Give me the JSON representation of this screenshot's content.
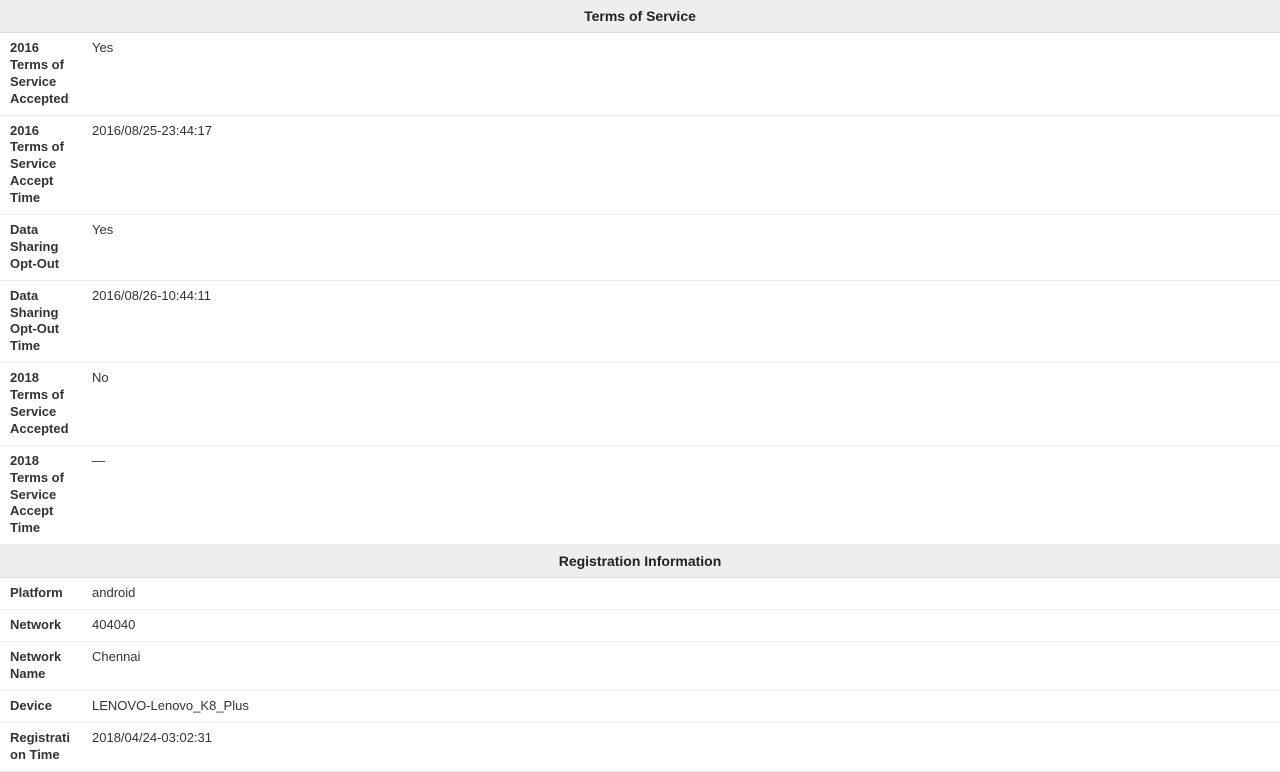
{
  "sections": [
    {
      "title": "Terms of Service",
      "rows": [
        {
          "label": "2016 Terms of Service Accepted",
          "value": "Yes"
        },
        {
          "label": "2016 Terms of Service Accept Time",
          "value": "2016/08/25-23:44:17"
        },
        {
          "label": "Data Sharing Opt-Out",
          "value": "Yes"
        },
        {
          "label": "Data Sharing Opt-Out Time",
          "value": "2016/08/26-10:44:11"
        },
        {
          "label": "2018 Terms of Service Accepted",
          "value": "No"
        },
        {
          "label": "2018 Terms of Service Accept Time",
          "value": "—"
        }
      ]
    },
    {
      "title": "Registration Information",
      "rows": [
        {
          "label": "Platform",
          "value": "android"
        },
        {
          "label": "Network",
          "value": "404040"
        },
        {
          "label": "Network Name",
          "value": "Chennai"
        },
        {
          "label": "Device",
          "value": "LENOVO-Lenovo_K8_Plus"
        },
        {
          "label": "Registration Time",
          "value": "2018/04/24-03:02:31"
        }
      ]
    }
  ]
}
